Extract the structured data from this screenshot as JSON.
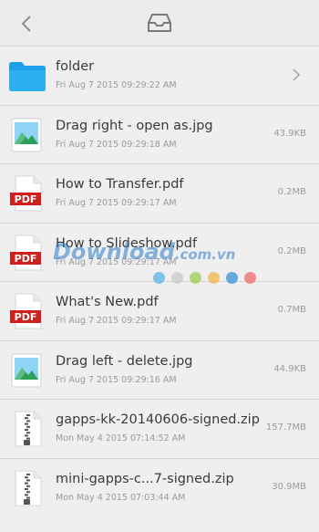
{
  "header": {
    "back_icon": "chevron-left-icon",
    "inbox_icon": "inbox-tray-icon"
  },
  "files": [
    {
      "icon": "folder-icon",
      "name": "folder",
      "date": "Fri Aug 7 2015 09:29:22 AM",
      "size": "",
      "is_folder": true
    },
    {
      "icon": "image-icon",
      "name": "Drag right - open as.jpg",
      "date": "Fri Aug 7 2015 09:29:18 AM",
      "size": "43.9KB"
    },
    {
      "icon": "pdf-icon",
      "name": "How to Transfer.pdf",
      "date": "Fri Aug 7 2015 09:29:17 AM",
      "size": "0.2MB"
    },
    {
      "icon": "pdf-icon",
      "name": "How to Slideshow.pdf",
      "date": "Fri Aug 7 2015 09:29:17 AM",
      "size": "0.2MB"
    },
    {
      "icon": "pdf-icon",
      "name": "What's New.pdf",
      "date": "Fri Aug 7 2015 09:29:17 AM",
      "size": "0.7MB"
    },
    {
      "icon": "image-icon",
      "name": "Drag left - delete.jpg",
      "date": "Fri Aug 7 2015 09:29:16 AM",
      "size": "44.9KB"
    },
    {
      "icon": "zip-icon",
      "name": "gapps-kk-20140606-signed.zip",
      "date": "Mon May 4 2015 07:14:52 AM",
      "size": "157.7MB"
    },
    {
      "icon": "zip-icon",
      "name": "mini-gapps-c...7-signed.zip",
      "date": "Mon May 4 2015 07:03:44 AM",
      "size": "30.9MB"
    }
  ],
  "pdf_label": "PDF",
  "watermark": {
    "text": "Download",
    "suffix": ".com.vn",
    "dot_colors": [
      "#55b4e8",
      "#c9c9c9",
      "#9ccc50",
      "#f2b64a",
      "#3a8fd8",
      "#f06a6a"
    ]
  },
  "colors": {
    "folder": "#1ea0e8",
    "pdf_red": "#d01f1f",
    "text": "#3a3a3a",
    "meta": "#9a9a9a"
  }
}
